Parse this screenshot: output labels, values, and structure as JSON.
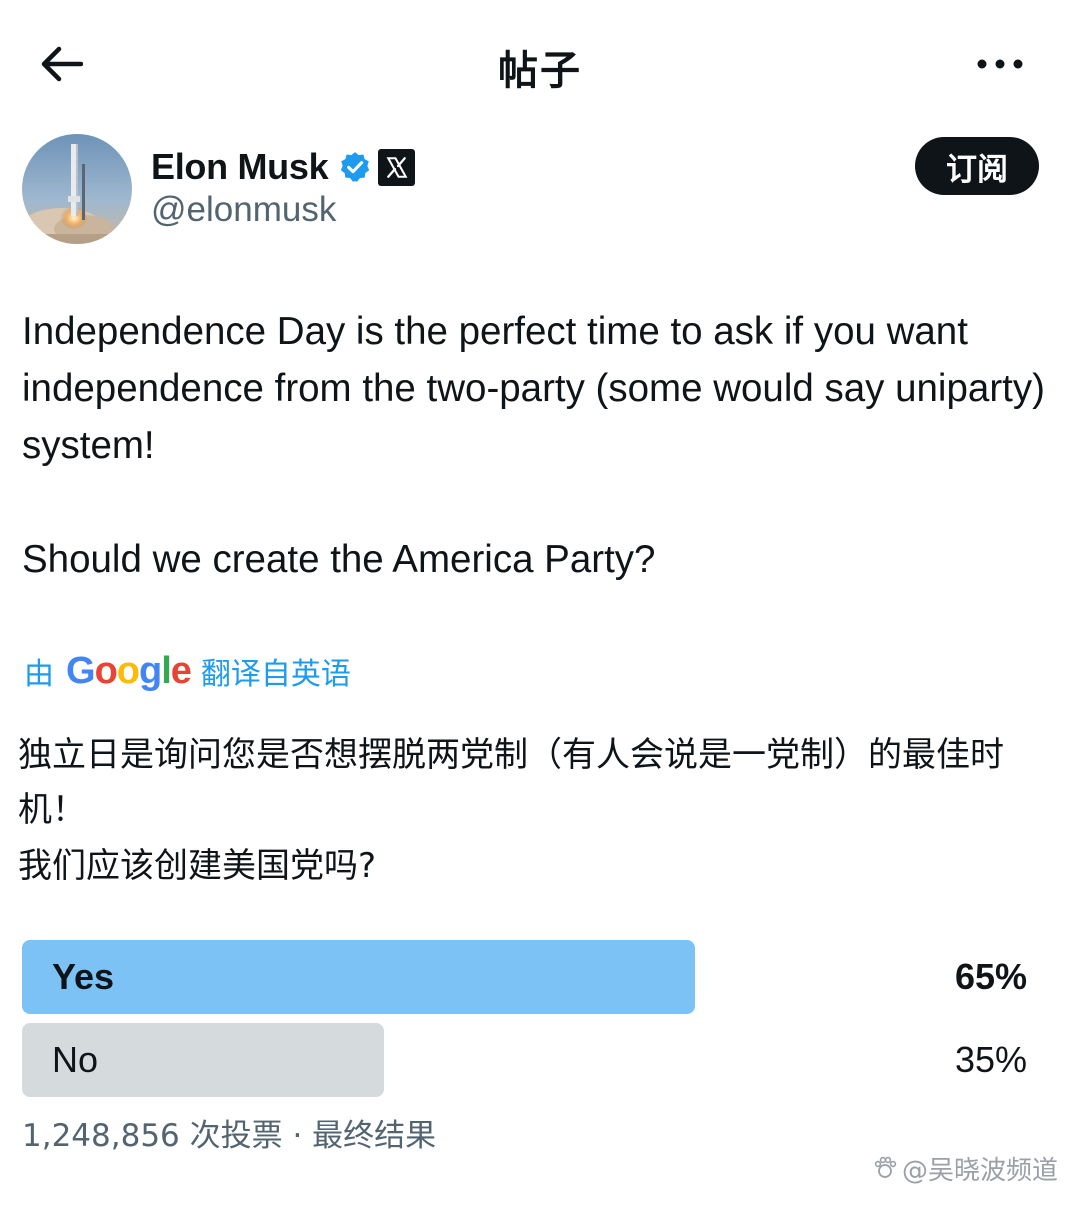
{
  "header": {
    "title": "帖子",
    "back_icon": "arrow-left-icon",
    "more_icon": "more-horizontal-icon"
  },
  "author": {
    "display_name": "Elon Musk",
    "handle": "@elonmusk",
    "verified_color": "#1d9bf0",
    "subscribe_label": "订阅"
  },
  "post": {
    "text": "Independence Day is the perfect time to ask if you want independence from the two-party (some would say uniparty) system!",
    "question": "Should we create the America Party?"
  },
  "translation": {
    "prefix": "由",
    "provider": "Google",
    "suffix": "翻译自英语",
    "text": "独立日是询问您是否想摆脱两党制（有人会说是一党制）的最佳时机！",
    "question": "我们应该创建美国党吗?"
  },
  "poll": {
    "options": [
      {
        "label": "Yes",
        "percent": "65%",
        "fraction": 0.65,
        "winner": true,
        "color": "#7cc2f5"
      },
      {
        "label": "No",
        "percent": "35%",
        "fraction": 0.35,
        "winner": false,
        "color": "#d5dadd"
      }
    ],
    "footer": "1,248,856 次投票 · 最终结果"
  },
  "watermark": {
    "text": "@吴晓波频道"
  },
  "colors": {
    "accent": "#1d9bf0",
    "text": "#0f1419",
    "secondary": "#536471"
  }
}
